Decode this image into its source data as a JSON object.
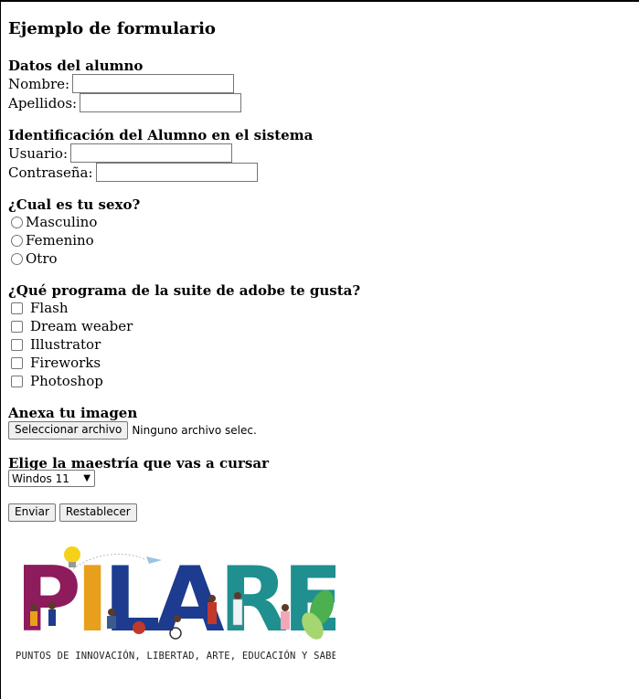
{
  "form": {
    "title": "Ejemplo de formulario",
    "student_data": {
      "heading": "Datos del alumno",
      "name_label": "Nombre:",
      "lastname_label": "Apellidos:"
    },
    "system_id": {
      "heading": "Identificación del Alumno en el sistema",
      "user_label": "Usuario:",
      "password_label": "Contraseña:"
    },
    "sex": {
      "heading": "¿Cual es tu sexo?",
      "options": [
        "Masculino",
        "Femenino",
        "Otro"
      ]
    },
    "adobe": {
      "heading": "¿Qué programa de la suite de adobe te gusta?",
      "options": [
        "Flash",
        "Dream weaber",
        "Illustrator",
        "Fireworks",
        "Photoshop"
      ]
    },
    "image": {
      "heading": "Anexa tu imagen",
      "button_label": "Seleccionar archivo",
      "file_status": "Ninguno archivo selec."
    },
    "master": {
      "heading": "Elige la maestría que vas a cursar",
      "selected": "Windos 11"
    },
    "submit_label": "Enviar",
    "reset_label": "Restablecer"
  },
  "logo": {
    "word": "PILARES",
    "tagline": "PUNTOS DE INNOVACIÓN, LIBERTAD, ARTE, EDUCACIÓN Y SABERES",
    "colors": [
      "#8e1b5c",
      "#e8a01c",
      "#1d3b8f",
      "#1f8f8f",
      "#2e7d32"
    ]
  }
}
